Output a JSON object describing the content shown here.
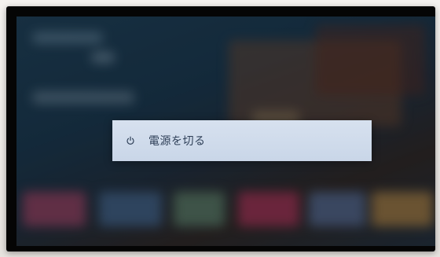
{
  "power_menu": {
    "items": [
      {
        "icon": "power-icon",
        "label": "電源を切る"
      }
    ]
  },
  "colors": {
    "menu_background": "#d2dcec",
    "menu_text": "#2e3f57",
    "tv_frame": "#050505"
  }
}
